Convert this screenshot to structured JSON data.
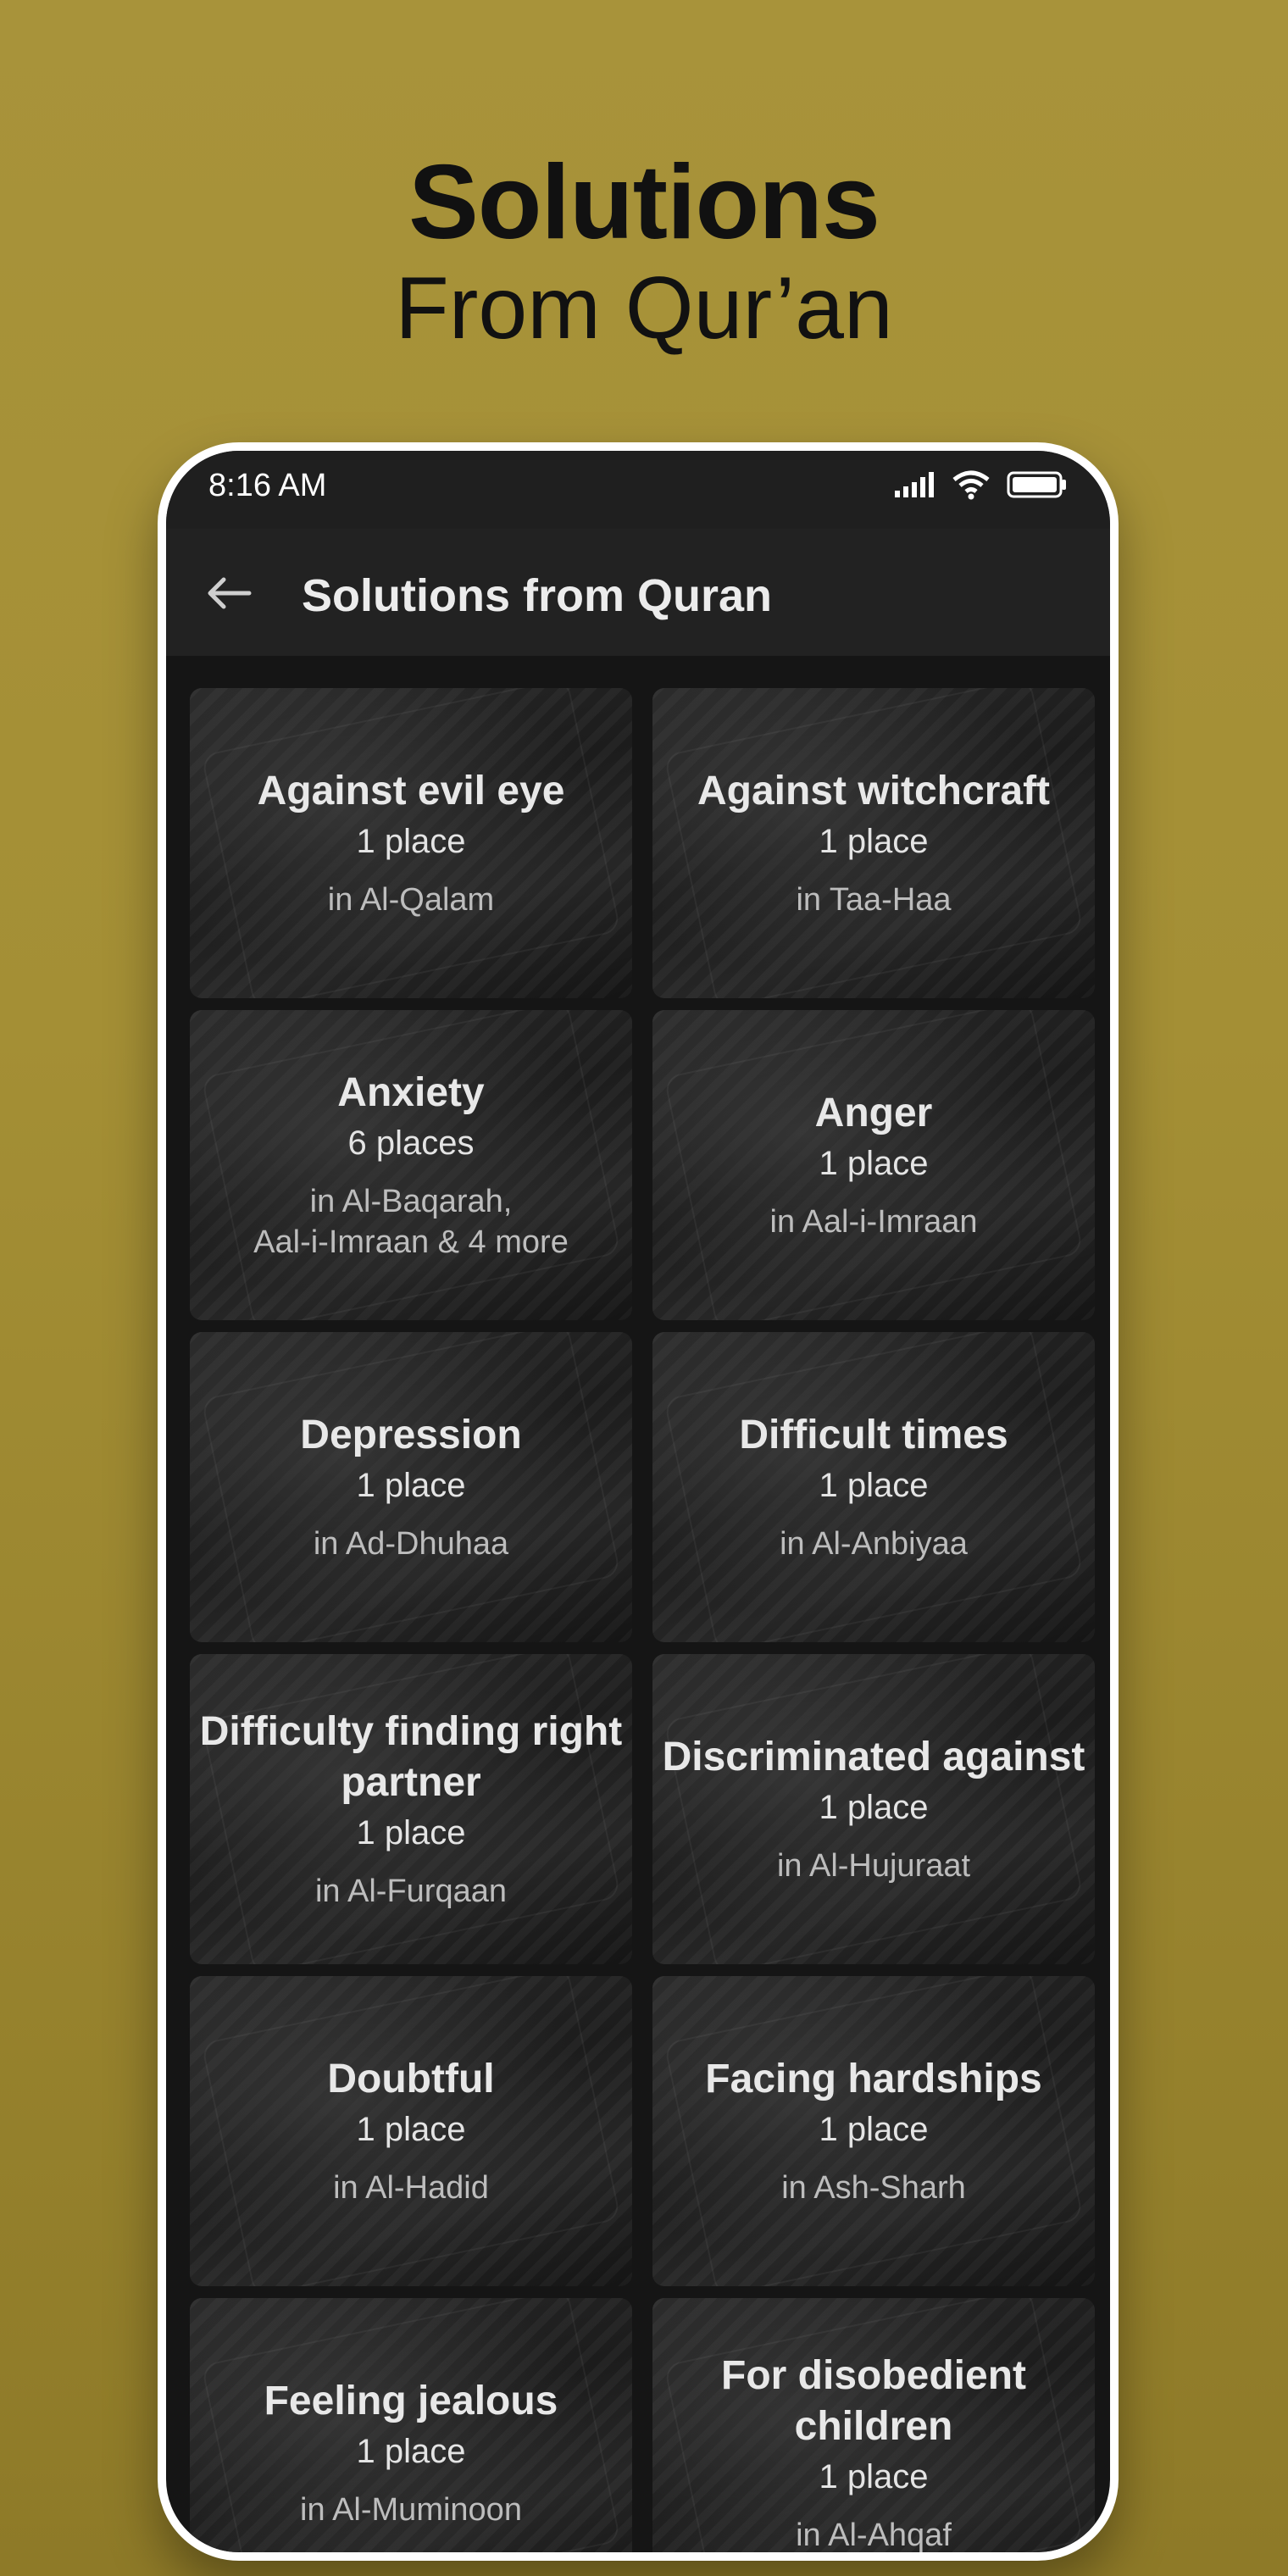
{
  "hero": {
    "title": "Solutions",
    "subtitle": "From Qur’an"
  },
  "status_bar": {
    "time": "8:16 AM"
  },
  "app_bar": {
    "title": "Solutions from Quran",
    "back_icon": "arrow-left-icon"
  },
  "colors": {
    "background": "#a8933a",
    "app_bar": "#222222",
    "card_text": "#e8e8e8"
  },
  "cards": [
    {
      "title": "Against evil eye",
      "count": "1 place",
      "location": [
        "in Al-Qalam"
      ]
    },
    {
      "title": "Against witchcraft",
      "count": "1 place",
      "location": [
        "in Taa-Haa"
      ]
    },
    {
      "title": "Anxiety",
      "count": "6 places",
      "location": [
        "in Al-Baqarah,",
        "Aal-i-Imraan & 4 more"
      ]
    },
    {
      "title": "Anger",
      "count": "1 place",
      "location": [
        "in Aal-i-Imraan"
      ]
    },
    {
      "title": "Depression",
      "count": "1 place",
      "location": [
        "in Ad-Dhuhaa"
      ]
    },
    {
      "title": "Difficult times",
      "count": "1 place",
      "location": [
        "in Al-Anbiyaa"
      ]
    },
    {
      "title": "Difficulty finding right partner",
      "count": "1 place",
      "location": [
        "in Al-Furqaan"
      ]
    },
    {
      "title": "Discriminated against",
      "count": "1 place",
      "location": [
        "in Al-Hujuraat"
      ]
    },
    {
      "title": "Doubtful",
      "count": "1 place",
      "location": [
        "in Al-Hadid"
      ]
    },
    {
      "title": "Facing hardships",
      "count": "1 place",
      "location": [
        "in Ash-Sharh"
      ]
    },
    {
      "title": "Feeling jealous",
      "count": "1 place",
      "location": [
        "in Al-Muminoon"
      ]
    },
    {
      "title": "For disobedient children",
      "count": "1 place",
      "location": [
        "in Al-Ahqaf"
      ]
    }
  ]
}
